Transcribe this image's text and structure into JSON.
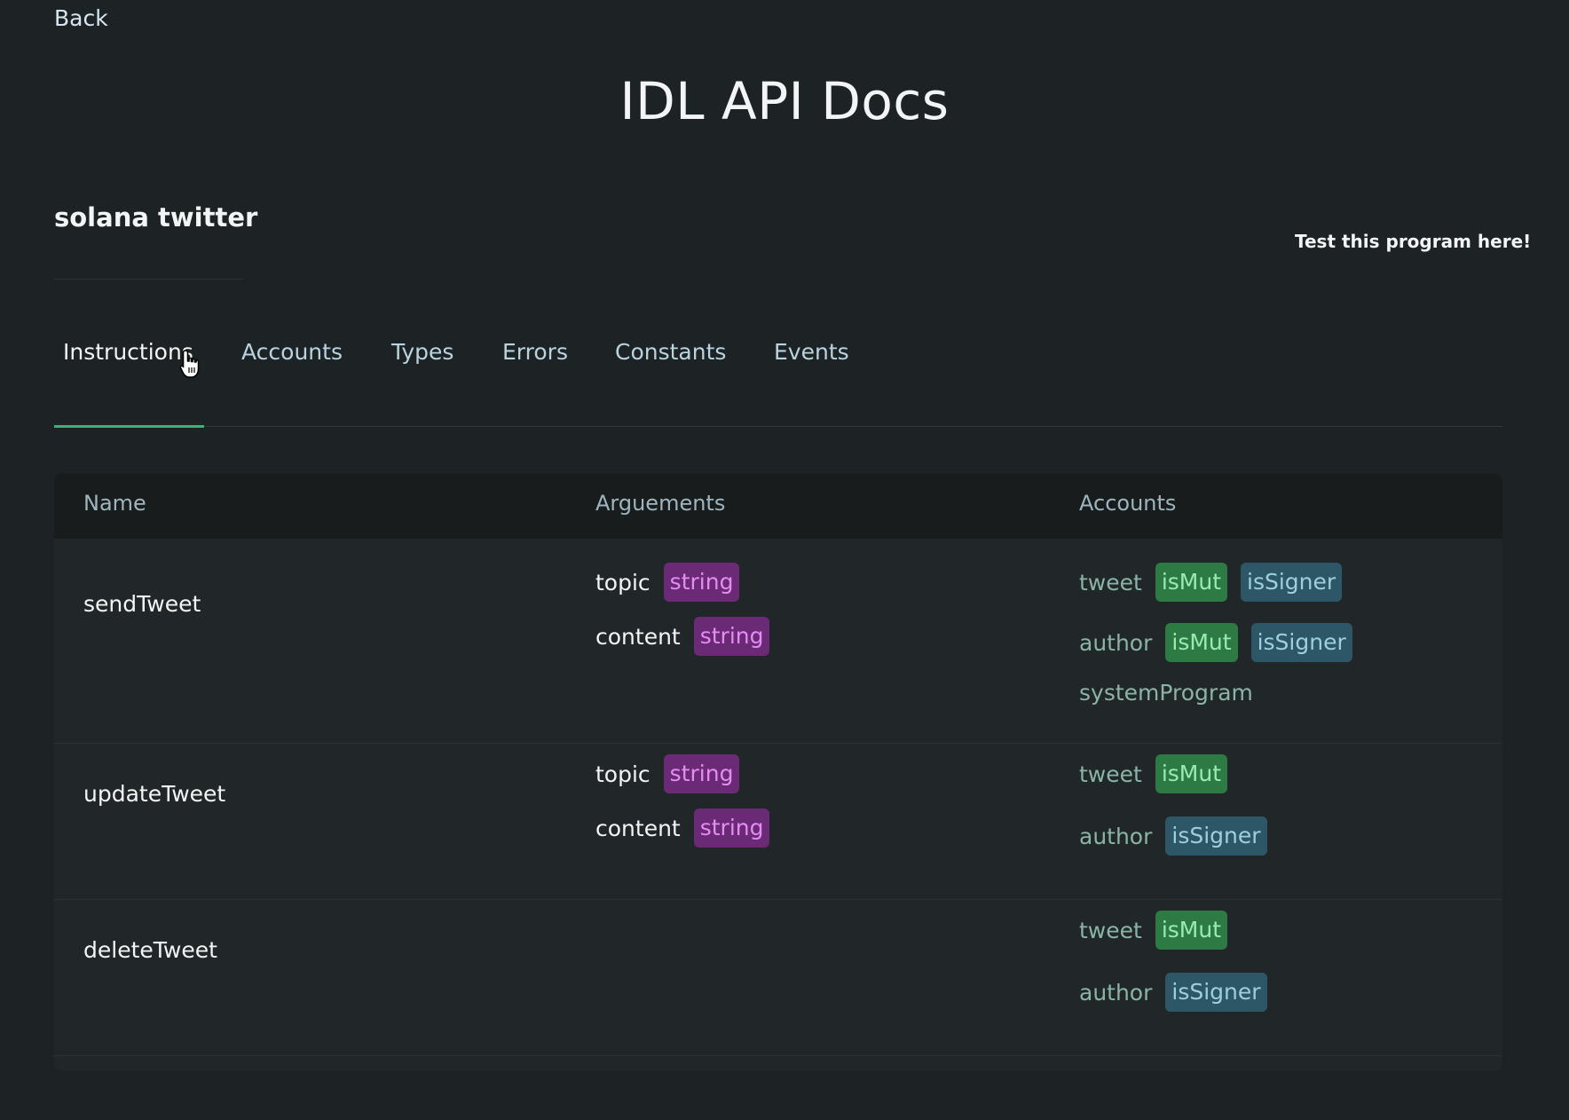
{
  "nav": {
    "back_label": "Back"
  },
  "page": {
    "title": "IDL API Docs"
  },
  "program": {
    "name": "solana twitter",
    "test_link": "Test this program here!"
  },
  "tabs": [
    {
      "label": "Instructions",
      "active": true
    },
    {
      "label": "Accounts",
      "active": false
    },
    {
      "label": "Types",
      "active": false
    },
    {
      "label": "Errors",
      "active": false
    },
    {
      "label": "Constants",
      "active": false
    },
    {
      "label": "Events",
      "active": false
    }
  ],
  "table": {
    "headers": {
      "name": "Name",
      "arguments": "Arguements",
      "accounts": "Accounts"
    },
    "rows": [
      {
        "name": "sendTweet",
        "args": [
          {
            "name": "topic",
            "type": "string"
          },
          {
            "name": "content",
            "type": "string"
          }
        ],
        "accounts": [
          {
            "name": "tweet",
            "isMut": "isMut",
            "isSigner": "isSigner"
          },
          {
            "name": "author",
            "isMut": "isMut",
            "isSigner": "isSigner"
          },
          {
            "name": "systemProgram"
          }
        ]
      },
      {
        "name": "updateTweet",
        "args": [
          {
            "name": "topic",
            "type": "string"
          },
          {
            "name": "content",
            "type": "string"
          }
        ],
        "accounts": [
          {
            "name": "tweet",
            "isMut": "isMut"
          },
          {
            "name": "author",
            "isSigner": "isSigner"
          }
        ]
      },
      {
        "name": "deleteTweet",
        "args": [],
        "accounts": [
          {
            "name": "tweet",
            "isMut": "isMut"
          },
          {
            "name": "author",
            "isSigner": "isSigner"
          }
        ]
      }
    ]
  },
  "colors": {
    "background": "#1d2224",
    "tab_indicator": "#3bb27c",
    "badge_type_bg": "#6b2a76",
    "badge_mut_bg": "#2d7a45",
    "badge_signer_bg": "#2d5766"
  },
  "icons": {
    "cursor": "hand-pointer-icon"
  }
}
